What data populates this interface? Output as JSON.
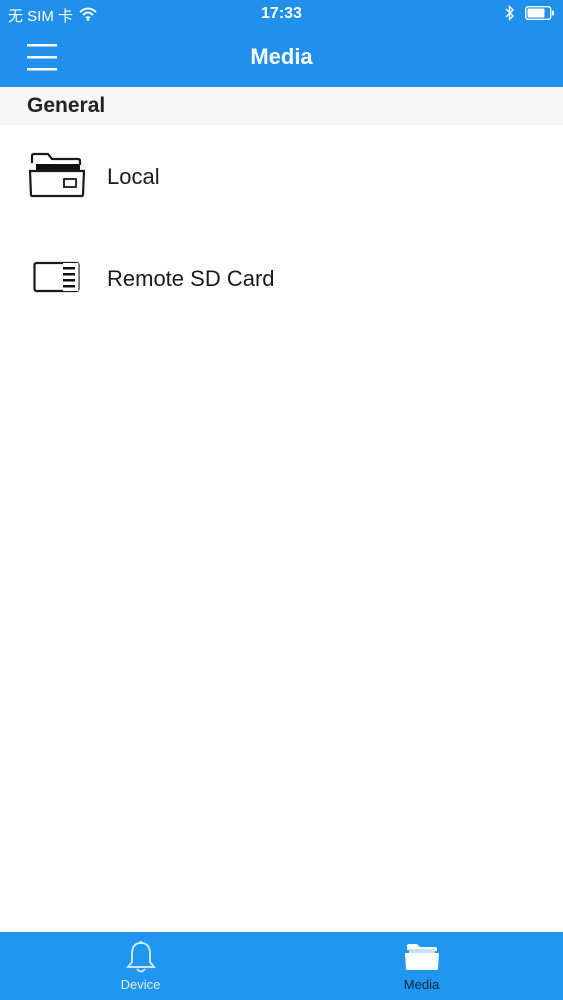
{
  "status_bar": {
    "carrier": "无 SIM 卡",
    "time": "17:33",
    "icons": [
      "wifi-icon",
      "bluetooth-icon",
      "battery-icon"
    ]
  },
  "header": {
    "title": "Media",
    "menu_icon": "hamburger-menu-icon"
  },
  "section": {
    "title": "General"
  },
  "items": [
    {
      "label": "Local",
      "icon": "folder-icon"
    },
    {
      "label": "Remote SD Card",
      "icon": "sd-card-icon"
    }
  ],
  "tab_bar": {
    "tabs": [
      {
        "label": "Device",
        "icon": "bell-icon",
        "selected": false
      },
      {
        "label": "Media",
        "icon": "folder-icon",
        "selected": true
      }
    ]
  },
  "colors": {
    "accent": "#1f90ec",
    "tab_bar": "#2196f0",
    "section_bg": "#f6f6f6"
  }
}
